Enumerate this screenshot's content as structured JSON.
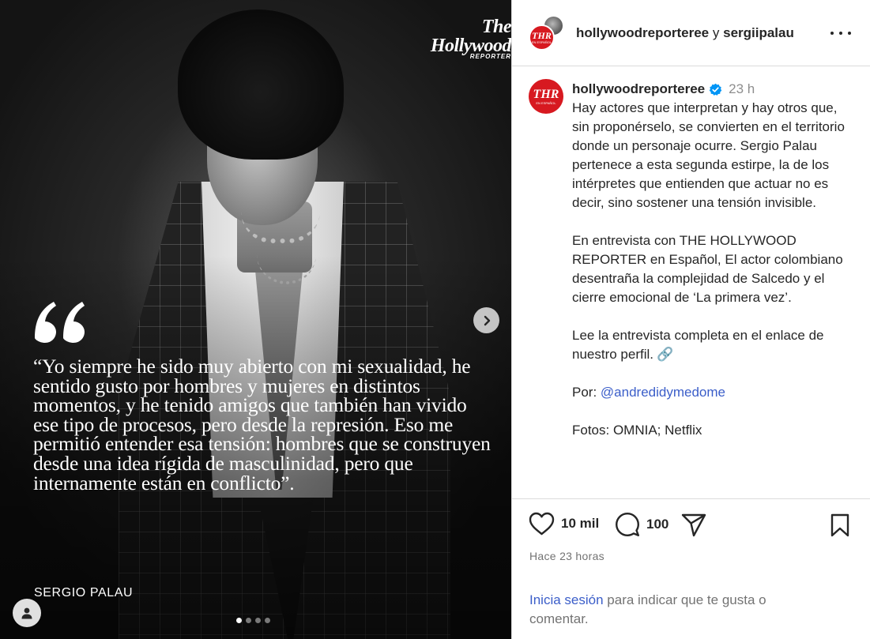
{
  "media": {
    "brand_logo": "The Hollywood Reporter",
    "quote": "“Yo siempre he sido muy abierto con mi sexualidad, he sentido gusto por hombres y mujeres en distintos momentos, y he tenido amigos que también han vivido ese tipo de procesos, pero desde la represión. Eso me permitió entender esa tensión: hombres que se construyen desde una idea rígida de masculinidad, pero que internamente están en conflicto”.",
    "author": "SERGIO PALAU",
    "carousel": {
      "slides": 4,
      "active": 1
    },
    "icons": {
      "next": "chevron-right-icon",
      "user": "user-icon",
      "quote": "quote-mark-icon"
    }
  },
  "header": {
    "account": "hollywoodreporteree",
    "joiner": "y",
    "collaborator": "sergiipalau",
    "avatar_text": "THR",
    "avatar_sub": "EN ESPAÑOL"
  },
  "caption": {
    "username": "hollywoodreporteree",
    "time": "23 h",
    "paragraph1": "Hay actores que interpretan y hay otros que, sin proponérselo, se convierten en el territorio donde un personaje ocurre. Sergio Palau pertenece a esta segunda estirpe, la de los intérpretes que entienden que actuar no es decir, sino sostener una tensión invisible.",
    "paragraph2": "En entrevista con THE HOLLYWOOD REPORTER en Español, El actor colombiano desentraña la complejidad de Salcedo y el cierre emocional de ‘La primera vez’.",
    "paragraph3": "Lee la entrevista completa en el enlace de nuestro perfil.",
    "link_emoji": "🔗",
    "credit_label": "Por:",
    "credit_mention": "@andredidymedome",
    "photos": "Fotos: OMNIA; Netflix"
  },
  "actions": {
    "likes": "10 mil",
    "comments": "100",
    "posted": "Hace 23 horas"
  },
  "login": {
    "link": "Inicia sesión",
    "rest": " para indicar que te gusta o comentar."
  },
  "colors": {
    "brand_red": "#d71920",
    "link_blue": "#3b5ec9",
    "verified_blue": "#0095f6"
  }
}
